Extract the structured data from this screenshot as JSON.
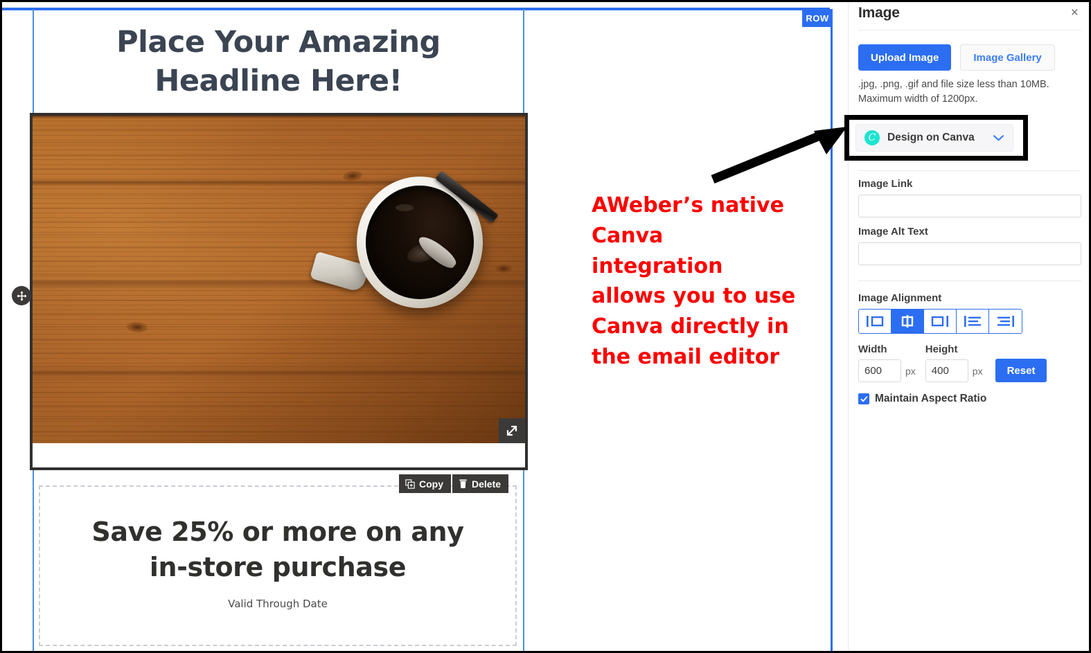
{
  "canvas": {
    "row_badge": "ROW",
    "headline": {
      "line1": "Place Your Amazing",
      "line2": "Headline Here!"
    },
    "image": {
      "alt": "Overhead photo of a white mug of black coffee with a spoon on a wooden table"
    },
    "block_toolbar": {
      "copy_label": "Copy",
      "delete_label": "Delete"
    },
    "coupon": {
      "line1": "Save 25% or more on any",
      "line2": "in-store purchase",
      "subtext": "Valid Through Date"
    }
  },
  "annotation": {
    "text": "AWeber’s native Canva integration allows you to use Canva directly in the email editor",
    "color": "#fd0000",
    "highlight_color": "#000000"
  },
  "panel": {
    "title": "Image",
    "close_label": "×",
    "upload_button": "Upload Image",
    "gallery_button": "Image Gallery",
    "hint": ".jpg, .png, .gif and file size less than 10MB. Maximum width of 1200px.",
    "canva": {
      "label": "Design on Canva",
      "logo_letter": "C",
      "logo_color": "#1be4d0"
    },
    "image_link": {
      "label": "Image Link",
      "value": "",
      "placeholder": ""
    },
    "image_alt_text": {
      "label": "Image Alt Text",
      "value": "",
      "placeholder": ""
    },
    "alignment": {
      "label": "Image Alignment",
      "options": [
        "align-left",
        "align-center",
        "align-right",
        "wrap-left",
        "wrap-right"
      ],
      "selected": "align-center"
    },
    "width": {
      "label": "Width",
      "value": "600",
      "unit": "px"
    },
    "height": {
      "label": "Height",
      "value": "400",
      "unit": "px"
    },
    "reset_button": "Reset",
    "maintain_aspect_ratio": {
      "label": "Maintain Aspect Ratio",
      "checked": true
    },
    "accent_color": "#2c6ef2"
  }
}
